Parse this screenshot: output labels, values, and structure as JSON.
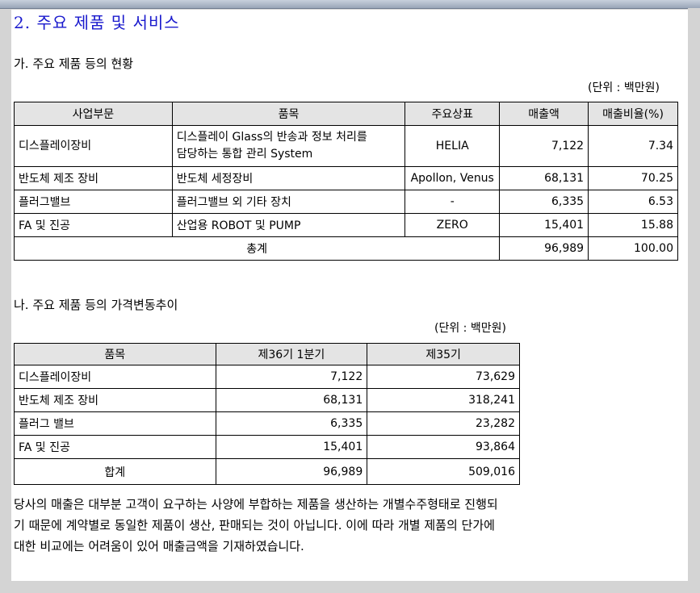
{
  "section_title": "2. 주요 제품 및 서비스",
  "part_a": {
    "heading": "가. 주요 제품 등의 현황",
    "unit": "(단위 : 백만원)",
    "headers": [
      "사업부문",
      "품목",
      "주요상표",
      "매출액",
      "매출비율(%)"
    ],
    "rows": [
      {
        "division": "디스플레이장비",
        "item_line1": "디스플레이 Glass의 반송과 정보 처리를",
        "item_line2": "담당하는 통합 관리 System",
        "brand": "HELIA",
        "sales": "7,122",
        "ratio": "7.34"
      },
      {
        "division": "반도체 제조 장비",
        "item": "반도체 세정장비",
        "brand": "Apollon, Venus",
        "sales": "68,131",
        "ratio": "70.25"
      },
      {
        "division": "플러그밸브",
        "item": "플러그밸브 외 기타 장치",
        "brand": "-",
        "sales": "6,335",
        "ratio": "6.53"
      },
      {
        "division": "FA 및 진공",
        "item": "산업용 ROBOT 및 PUMP",
        "brand": "ZERO",
        "sales": "15,401",
        "ratio": "15.88"
      }
    ],
    "total": {
      "label": "총계",
      "sales": "96,989",
      "ratio": "100.00"
    }
  },
  "part_b": {
    "heading": "나. 주요 제품 등의 가격변동추이",
    "unit": "(단위 : 백만원)",
    "headers": [
      "품목",
      "제36기 1분기",
      "제35기"
    ],
    "rows": [
      {
        "item": "디스플레이장비",
        "q1": "7,122",
        "prev": "73,629"
      },
      {
        "item": "반도체 제조 장비",
        "q1": "68,131",
        "prev": "318,241"
      },
      {
        "item": "플러그 밸브",
        "q1": "6,335",
        "prev": "23,282"
      },
      {
        "item": "FA 및 진공",
        "q1": "15,401",
        "prev": "93,864"
      }
    ],
    "total": {
      "label": "합계",
      "q1": "96,989",
      "prev": "509,016"
    }
  },
  "note": "당사의 매출은 대부분 고객이 요구하는 사양에 부합하는 제품을 생산하는 개별수주형태로 진행되기 때문에 계약별로 동일한 제품이 생산, 판매되는 것이 아닙니다. 이에 따라 개별 제품의 단가에 대한 비교에는 어려움이 있어 매출금액을 기재하였습니다."
}
